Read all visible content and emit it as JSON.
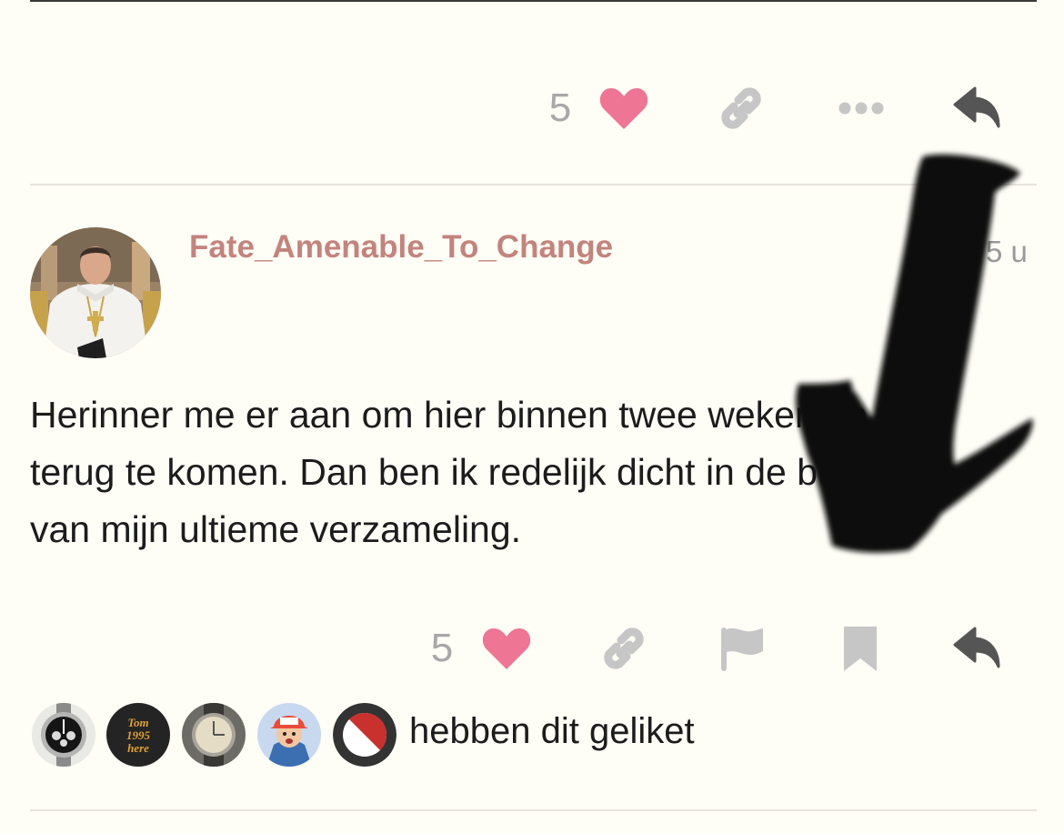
{
  "previous_post": {
    "like_count": "5",
    "icons": [
      "heart-icon",
      "link-icon",
      "more-icon",
      "reply-icon"
    ]
  },
  "post": {
    "username": "Fate_Amenable_To_Change",
    "timestamp": "5 u",
    "body_lines": [
      "Herinner me er aan om hier binnen twee weken op",
      "terug te komen. Dan ben ik redelijk dicht in de buurt",
      "van mijn ultieme verzameling."
    ],
    "like_count": "5",
    "icons": [
      "heart-icon",
      "link-icon",
      "flag-icon",
      "bookmark-icon",
      "reply-icon"
    ],
    "likers_text": "hebben dit geliket",
    "liker_avatar_text": "Tom 1995 here"
  },
  "colors": {
    "heart": "#ee7593",
    "icon_grey": "#c6c6c6",
    "icon_dark": "#555555",
    "username": "#c2847d",
    "background": "#fefdf6"
  }
}
